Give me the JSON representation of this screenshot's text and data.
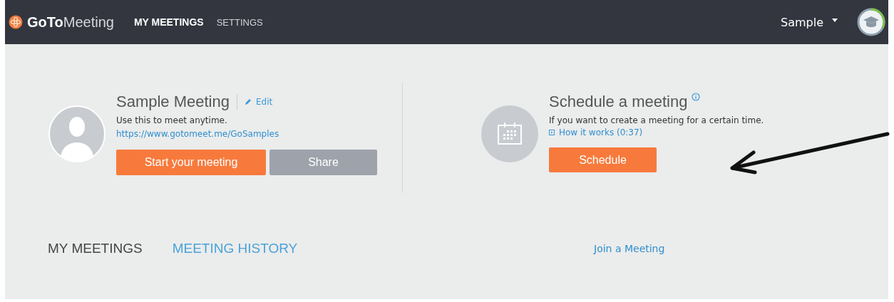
{
  "header": {
    "logo": "**GoTo**Meeting",
    "nav": [
      {
        "label": "MY MEETINGS",
        "selected": true
      },
      {
        "label": "SETTINGS",
        "selected": false
      }
    ],
    "user": "Sample"
  },
  "meeting": {
    "title": "Sample Meeting",
    "edit": "Edit",
    "description": "Use this to meet anytime.",
    "link": "https://www.gotomeet.me/GoSamples",
    "buttons": [
      {
        "label": "Start your meeting",
        "kind": "primary"
      },
      {
        "label": "Share",
        "kind": "secondary"
      }
    ]
  },
  "schedule": {
    "title": "Schedule a meeting",
    "description": "If you want to create a meeting for a certain time.",
    "video_link": "How it works (0:37)",
    "button": "Schedule"
  },
  "tabs": [
    {
      "label": "MY MEETINGS",
      "selected": true
    },
    {
      "label": "MEETING HISTORY",
      "selected": false
    }
  ],
  "join_link": "Join a Meeting"
}
